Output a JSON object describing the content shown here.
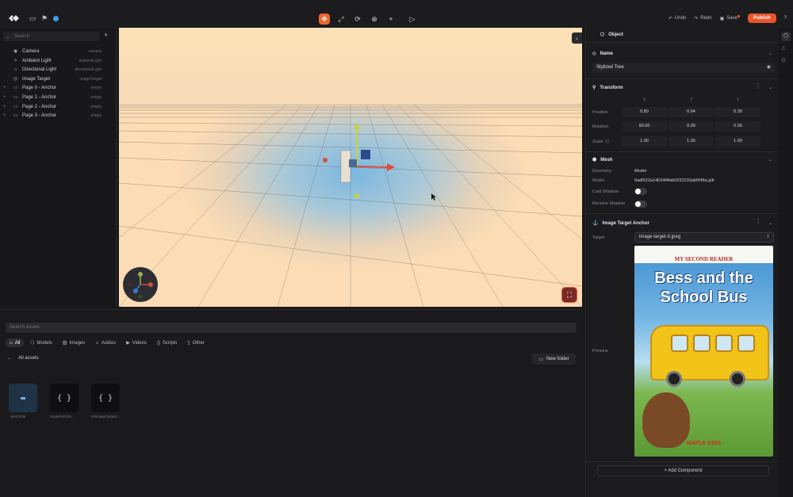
{
  "topbar": {
    "undo": "Undo",
    "redo": "Redo",
    "save": "Save",
    "publish": "Publish"
  },
  "hierarchy": {
    "search_placeholder": "Search",
    "items": [
      {
        "name": "Camera",
        "type": "camera",
        "icon": "camera-icon"
      },
      {
        "name": "Ambient Light",
        "type": "ambientLight",
        "icon": "light-icon"
      },
      {
        "name": "Directional Light",
        "type": "directionalLight",
        "icon": "sun-icon"
      },
      {
        "name": "Image Target",
        "type": "imageTarget",
        "icon": "image-target-icon"
      },
      {
        "name": "Page 0 - Anchor",
        "type": "empty",
        "icon": "folder-icon"
      },
      {
        "name": "Page 1 - Anchor",
        "type": "empty",
        "icon": "folder-icon"
      },
      {
        "name": "Page 2 - Anchor",
        "type": "empty",
        "icon": "folder-icon"
      },
      {
        "name": "Page 3 - Anchor",
        "type": "empty",
        "icon": "folder-icon"
      }
    ]
  },
  "inspector": {
    "header": "Object",
    "name_section": "Name",
    "name_value": "Stylized Tree",
    "transform_section": "Transform",
    "axes": [
      "X",
      "Y",
      "Z"
    ],
    "position_label": "Position",
    "position": [
      "0.80",
      "0.64",
      "0.39"
    ],
    "rotation_label": "Rotation",
    "rotation": [
      "90.00",
      "0.00",
      "0.00"
    ],
    "scale_label": "Scale",
    "scale": [
      "1.00",
      "1.00",
      "1.00"
    ],
    "mesh_section": "Mesh",
    "geometry_label": "Geometry",
    "geometry_value": "Model",
    "model_label": "Model",
    "model_value": "0adf522a14634f4fab0252233ab5f48a.glb",
    "cast_shadow_label": "Cast Shadow",
    "receive_shadow_label": "Receive Shadow",
    "anchor_section": "Image Target Anchor",
    "target_label": "Target",
    "target_value": "image-target-0.jpeg",
    "preview_label": "Preview",
    "add_component": "Add Component"
  },
  "book": {
    "series": "MY SECOND READER",
    "title_line1": "Bess and the",
    "title_line2": "School Bus",
    "publisher": "MAPLE KIDS"
  },
  "assets": {
    "search_placeholder": "Search assets",
    "filters": [
      "All",
      "Models",
      "Images",
      "Audios",
      "Videos",
      "Scripts",
      "Other"
    ],
    "breadcrumb": "All assets",
    "new_folder": "New folder",
    "files": [
      {
        "name": "sketchfab",
        "kind": "folder"
      },
      {
        "name": "ScaleRefUtils...",
        "kind": "script"
      },
      {
        "name": "initImageTargets...",
        "kind": "script"
      }
    ]
  },
  "colors": {
    "accent": "#f0642d",
    "publish": "#e9552b",
    "panel": "#1c1c1f"
  }
}
